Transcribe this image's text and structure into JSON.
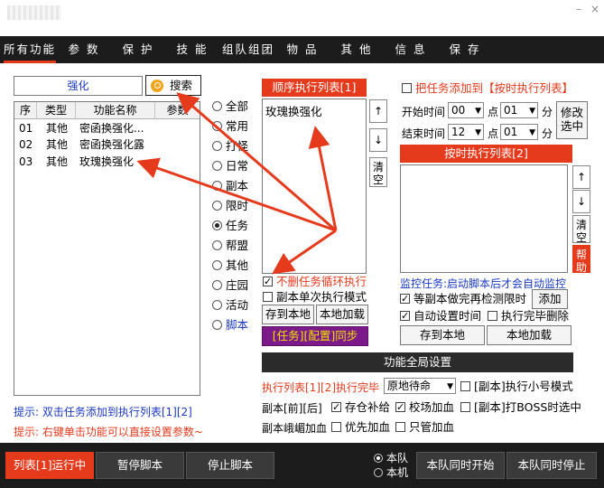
{
  "tabs": [
    "所有功能",
    "参 数",
    "保 护",
    "技 能",
    "组队组团",
    "物 品",
    "其 他",
    "信 息",
    "保 存"
  ],
  "search": {
    "value": "强化",
    "button": "搜索"
  },
  "table": {
    "headers": [
      "序",
      "类型",
      "功能名称",
      "参数"
    ],
    "rows": [
      {
        "no": "01",
        "type": "其他",
        "name": "密函换强化..."
      },
      {
        "no": "02",
        "type": "其他",
        "name": "密函换强化露"
      },
      {
        "no": "03",
        "type": "其他",
        "name": "玫瑰换强化"
      }
    ]
  },
  "radios": [
    "全部",
    "常用",
    "打怪",
    "日常",
    "副本",
    "限时",
    "任务",
    "帮盟",
    "其他",
    "庄园",
    "活动",
    "脚本"
  ],
  "seq_list": {
    "title": "顺序执行列表[1]",
    "items": [
      "玫瑰换强化"
    ],
    "up": "↑",
    "down": "↓",
    "clear": "清空",
    "chk_loop": "不删任务循环执行",
    "chk_single": "副本单次执行模式",
    "save": "存到本地",
    "load": "本地加载",
    "sync": "[任务][配置]同步"
  },
  "timed": {
    "chk_add": "把任务添加到【按时执行列表】",
    "start_label": "开始时间",
    "start_h": "00",
    "start_m": "01",
    "end_label": "结束时间",
    "end_h": "12",
    "end_m": "01",
    "point": "点",
    "minute": "分",
    "modify": "修改选中",
    "title": "按时执行列表[2]",
    "up": "↑",
    "down": "↓",
    "clear": "清空",
    "help": "帮助",
    "monitor": "监控任务:启动脚本后才会自动监控",
    "chk_wait": "等副本做完再检测限时",
    "add": "添加",
    "chk_auto": "自动设置时间",
    "chk_delete": "执行完毕删除",
    "save": "存到本地",
    "load": "本地加载"
  },
  "global": {
    "title": "功能全局设置",
    "line1_label": "执行列表[1][2]执行完毕",
    "line1_select": "原地待命",
    "line1_chk": "[副本]执行小号模式",
    "line2_label": "副本[前][后]",
    "chk_store": "存仓补给",
    "chk_school": "校场加血",
    "chk_boss": "[副本]打BOSS时选中",
    "line3_label": "副本峨嵋加血",
    "chk_priority": "优先加血",
    "chk_only": "只管加血"
  },
  "tips": {
    "tip1": "提示: 双击任务添加到执行列表[1][2]",
    "tip2": "提示: 右键单击功能可以直接设置参数~"
  },
  "bottom": {
    "run": "列表[1]运行中",
    "pause": "暂停脚本",
    "stop": "停止脚本",
    "radio_team": "本队",
    "radio_local": "本机",
    "start_all": "本队同时开始",
    "stop_all": "本队同时停止"
  },
  "colors": {
    "accent": "#e63a1d",
    "dark": "#1c1c1c",
    "blue_text": "#1a38c0"
  }
}
